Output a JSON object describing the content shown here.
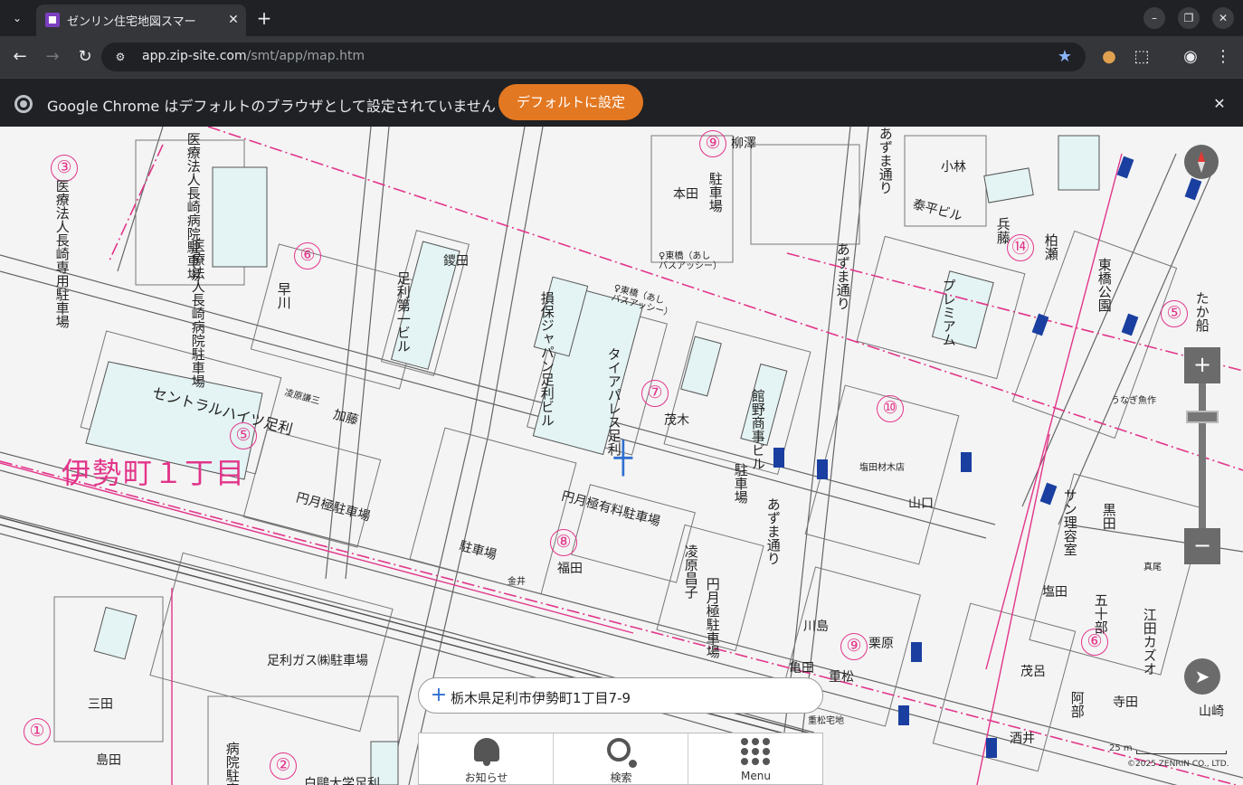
{
  "browser": {
    "tab_title": "ゼンリン住宅地図スマー",
    "tab_close": "✕",
    "new_tab": "+",
    "url_host": "app.zip-site.com",
    "url_path": "/smt/app/map.htm",
    "win_min": "–",
    "win_restore": "❐",
    "win_close": "✕",
    "back": "←",
    "forward": "→",
    "reload": "↻"
  },
  "infobar": {
    "message": "Google Chrome はデフォルトのブラウザとして設定されていません",
    "button": "デフォルトに設定",
    "close": "✕"
  },
  "map": {
    "district": "伊勢町１丁目",
    "block_numbers": [
      "③",
      "⑥",
      "⑤",
      "⑦",
      "⑧",
      "⑨",
      "⑨",
      "⑩",
      "⑭",
      "⑤",
      "⑥",
      "①",
      "②"
    ],
    "roads": [
      "あずま通り",
      "あずま通り",
      "あずま通り"
    ],
    "bus_stop_1": "♀東橋（あし\nバスアッシー）",
    "bus_stop_2": "♀東橋（あし\nバスアッシー）",
    "park": "東橋公園",
    "buildings_v": [
      "医療法人長崎病院駐車場",
      "医療法人長崎病院駐車場",
      "医療法人長崎専用駐車場",
      "足利第一ビル",
      "損保ジャパン足利ビル",
      "タイアパレス足利",
      "館野商事ビル",
      "駐車場",
      "凌原昌子",
      "円月極駐車場",
      "本田",
      "駐車場",
      "柳澤",
      "泰平ビル",
      "兵藤",
      "柏瀬",
      "プレミアム",
      "サン理容室",
      "江田カズオ",
      "五十部",
      "病院駐車場"
    ],
    "buildings_h": [
      "セントラルハイツ足利",
      "円月極駐車場",
      "円月極有料駐車場",
      "足利ガス㈱駐車場",
      "加藤",
      "凌原謙三",
      "茂木",
      "福田",
      "駐車場",
      "塩田材木店",
      "山口",
      "栗原",
      "川島",
      "亀田",
      "重松",
      "茂呂",
      "阿部",
      "寺田",
      "酒井",
      "山崎",
      "真尾",
      "塩田",
      "三田",
      "島田",
      "小林",
      "黒田",
      "早川",
      "鑁田",
      "金井",
      "重松宅地",
      "うなぎ魚作",
      "たか船",
      "白鷗大学足利"
    ],
    "crosshair": "┼",
    "scale_text": "25 m",
    "copyright": "©2025 ZENRIN CO., LTD."
  },
  "controls": {
    "zoom_in": "+",
    "zoom_out": "−",
    "locate": "➤"
  },
  "address": {
    "plus": "+",
    "text": "栃木県足利市伊勢町1丁目7-9"
  },
  "nav": {
    "news": "お知らせ",
    "search": "検索",
    "menu": "Menu"
  }
}
